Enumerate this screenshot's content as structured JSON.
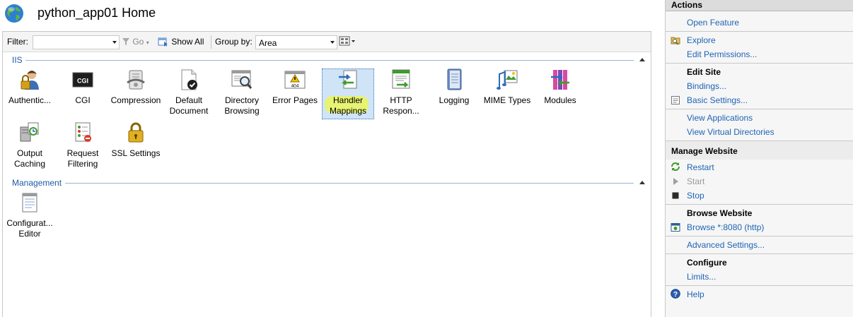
{
  "window": {
    "title": "python_app01 Home"
  },
  "toolbar": {
    "filter_label": "Filter:",
    "filter_value": "",
    "go_label": "Go",
    "show_all_label": "Show All",
    "group_by_label": "Group by:",
    "group_by_value": "Area"
  },
  "groups": {
    "iis": {
      "label": "IIS",
      "features": [
        {
          "label": "Authentic...",
          "icon": "authentication-icon"
        },
        {
          "label": "CGI",
          "icon": "cgi-icon"
        },
        {
          "label": "Compression",
          "icon": "compression-icon"
        },
        {
          "label": "Default Document",
          "icon": "default-document-icon"
        },
        {
          "label": "Directory Browsing",
          "icon": "directory-browsing-icon"
        },
        {
          "label": "Error Pages",
          "icon": "error-pages-icon"
        },
        {
          "label": "Handler Mappings",
          "icon": "handler-mappings-icon",
          "selected": true
        },
        {
          "label": "HTTP Respon...",
          "icon": "http-response-icon"
        },
        {
          "label": "Logging",
          "icon": "logging-icon"
        },
        {
          "label": "MIME Types",
          "icon": "mime-types-icon"
        },
        {
          "label": "Modules",
          "icon": "modules-icon"
        },
        {
          "label": "Output Caching",
          "icon": "output-caching-icon"
        },
        {
          "label": "Request Filtering",
          "icon": "request-filtering-icon"
        },
        {
          "label": "SSL Settings",
          "icon": "ssl-settings-icon"
        }
      ]
    },
    "management": {
      "label": "Management",
      "features": [
        {
          "label": "Configurat... Editor",
          "icon": "configuration-editor-icon"
        }
      ]
    }
  },
  "cgi_icon_text": "CGI",
  "error_icon_text": "404",
  "actions": {
    "header": "Actions",
    "open_feature": "Open Feature",
    "explore": "Explore",
    "edit_permissions": "Edit Permissions...",
    "edit_site": "Edit Site",
    "bindings": "Bindings...",
    "basic_settings": "Basic Settings...",
    "view_applications": "View Applications",
    "view_virtual_directories": "View Virtual Directories",
    "manage_website": "Manage Website",
    "restart": "Restart",
    "start": "Start",
    "stop": "Stop",
    "browse_website": "Browse Website",
    "browse_link": "Browse *:8080 (http)",
    "advanced_settings": "Advanced Settings...",
    "configure": "Configure",
    "limits": "Limits...",
    "help": "Help"
  },
  "colors": {
    "link": "#1e64b4",
    "group_header": "#1e5aa8",
    "selection": "#cfe4f7",
    "highlight": "#e8f36a"
  }
}
